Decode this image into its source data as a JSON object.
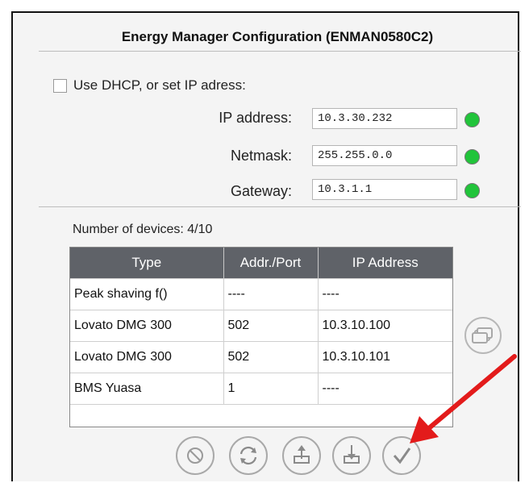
{
  "title": "Energy Manager Configuration (ENMAN0580C2)",
  "dhcp_label": "Use DHCP, or set IP adress:",
  "network": {
    "ip_label": "IP address:",
    "ip_value": "10.3.30.232",
    "netmask_label": "Netmask:",
    "netmask_value": "255.255.0.0",
    "gateway_label": "Gateway:",
    "gateway_value": "10.3.1.1"
  },
  "devices": {
    "count_label": "Number of devices: 4/10",
    "headers": [
      "Type",
      "Addr./Port",
      "IP Address"
    ],
    "rows": [
      [
        "Peak shaving f()",
        "----",
        "----"
      ],
      [
        "Lovato DMG 300",
        "502",
        "10.3.10.100"
      ],
      [
        "Lovato DMG 300",
        "502",
        "10.3.10.101"
      ],
      [
        "BMS Yuasa",
        "1",
        "----"
      ]
    ]
  },
  "colors": {
    "status_ok": "#21c43a",
    "table_header": "#5f6268",
    "annotation_arrow": "#e31b1b"
  },
  "icons": {
    "cancel": "cancel-icon",
    "refresh": "refresh-icon",
    "upload": "upload-icon",
    "download": "download-icon",
    "confirm": "check-icon",
    "side": "copy-icon"
  }
}
